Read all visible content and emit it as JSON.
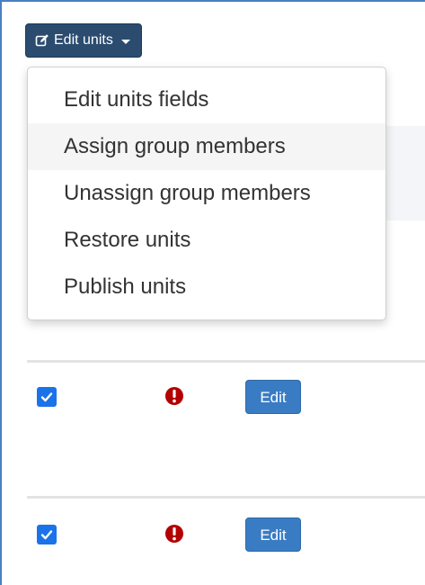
{
  "toolbar": {
    "edit_units_label": "Edit units",
    "edit_units_icon": "edit-icon",
    "caret_icon": "caret-down-icon"
  },
  "menu": {
    "items": [
      {
        "label": "Edit units fields"
      },
      {
        "label": "Assign group members",
        "hovered": true
      },
      {
        "label": "Unassign group members"
      },
      {
        "label": "Restore units"
      },
      {
        "label": "Publish units"
      }
    ]
  },
  "rows": [
    {
      "checked": true,
      "status_icon": "exclamation-circle-icon",
      "status_color": "#b30000",
      "edit_label": "Edit"
    },
    {
      "checked": true,
      "status_icon": "exclamation-circle-icon",
      "status_color": "#b30000",
      "edit_label": "Edit"
    }
  ],
  "colors": {
    "toggle_bg": "#2b4c6f",
    "edit_button_bg": "#3a7cc3",
    "checkbox_bg": "#1a73e8",
    "frame_border": "#4a7fc1"
  }
}
